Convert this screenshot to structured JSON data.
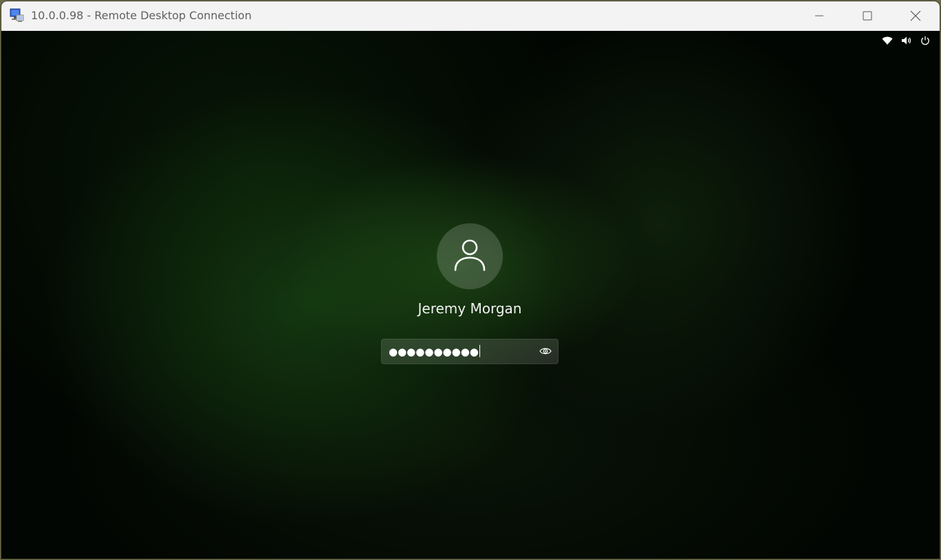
{
  "window": {
    "title": "10.0.0.98 - Remote Desktop Connection",
    "app_icon": "remote-desktop-icon",
    "controls": {
      "minimize_icon": "minimize-icon",
      "maximize_icon": "maximize-icon",
      "close_icon": "close-icon"
    }
  },
  "tray": {
    "icons": [
      "wifi-icon",
      "volume-icon",
      "power-icon"
    ]
  },
  "login": {
    "avatar_icon": "user-icon",
    "user_name": "Jeremy Morgan",
    "password_masked": "●●●●●●●●●●",
    "reveal_icon": "eye-icon"
  },
  "colors": {
    "accent_green": "#1e4a14",
    "titlebar_bg": "#f3f3f3",
    "text_light": "#f2f2f2"
  }
}
